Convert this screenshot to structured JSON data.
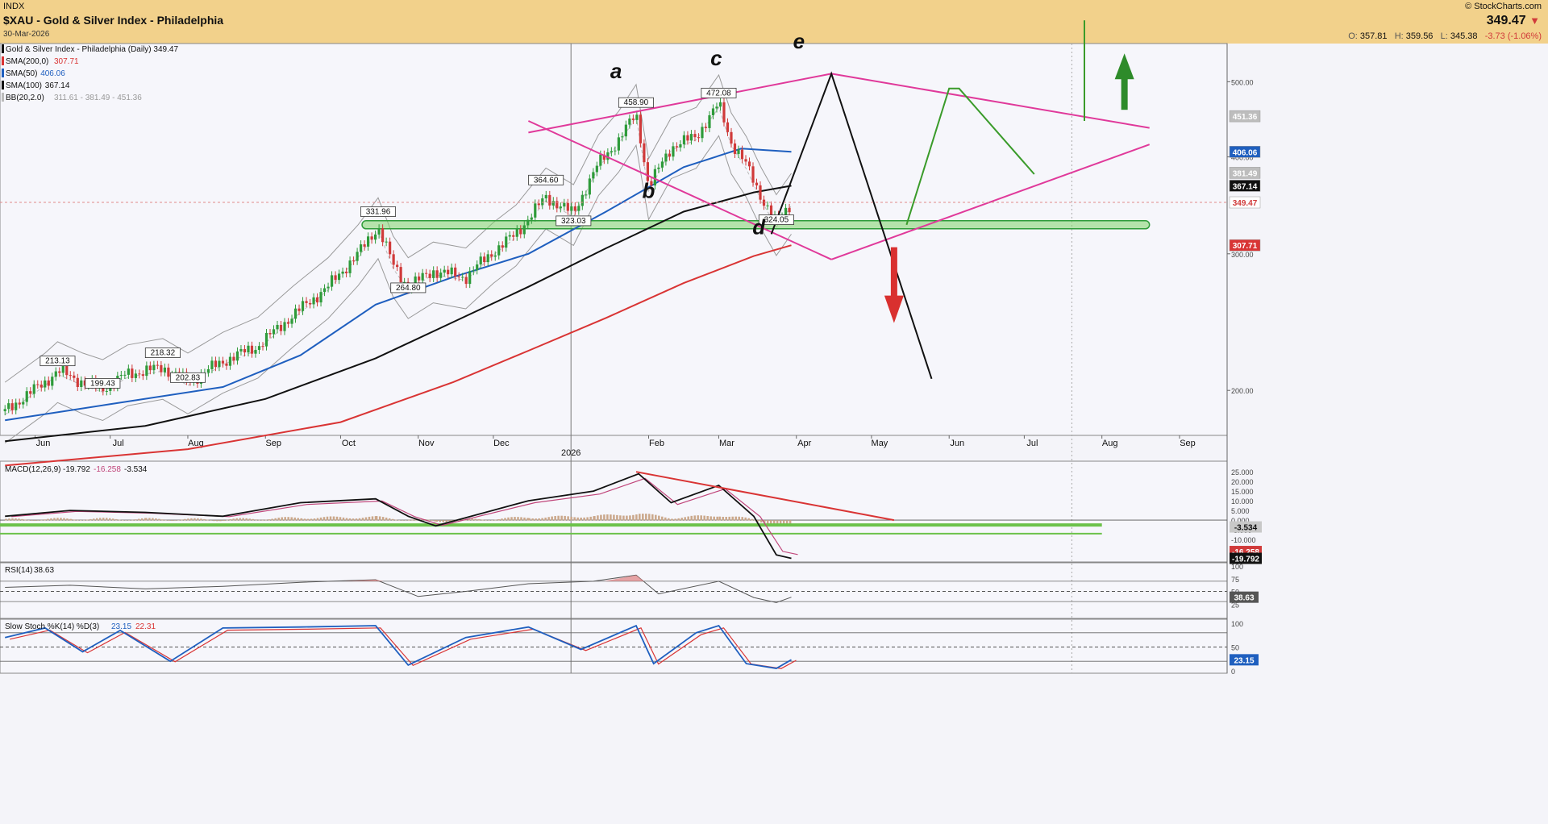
{
  "header": {
    "exchange": "INDX",
    "title": "$XAU - Gold & Silver Index - Philadelphia",
    "date": "30-Mar-2026",
    "brand": "© StockCharts.com",
    "last_price": "349.47",
    "ohlc_open_label": "O:",
    "ohlc_open": "357.81",
    "ohlc_high_label": "H:",
    "ohlc_high": "359.56",
    "ohlc_low_label": "L:",
    "ohlc_low": "345.38",
    "change": "-3.73 (-1.06%)"
  },
  "colors": {
    "header_bg": "#f2d18b",
    "up_candle": "#2e9b3a",
    "down_candle": "#d03a3a",
    "sma200": "#d93434",
    "sma50": "#1f5fbf",
    "sma100": "#111111",
    "bb": "#9a9a9a",
    "triangle": "#e0399a",
    "support_zone": "#7fd36a",
    "projection_green": "#3a9b2a",
    "projection_black": "#111111",
    "down_arrow": "#d9302f",
    "up_arrow": "#2e8b2a"
  },
  "legend_main": [
    {
      "label": "Gold & Silver Index - Philadelphia (Daily) 349.47",
      "values": "",
      "swatch": "#111111"
    },
    {
      "label": "SMA(200,0)",
      "values": "307.71",
      "swatch": "#d93434"
    },
    {
      "label": "SMA(50)",
      "values": "406.06",
      "swatch": "#1f5fbf"
    },
    {
      "label": "SMA(100)",
      "values": "367.14",
      "swatch": "#111111"
    },
    {
      "label": "BB(20,2.0)",
      "values": "311.61 - 381.49 - 451.36",
      "swatch": "#bbbbbb"
    }
  ],
  "chart_data": {
    "type": "line",
    "title": "$XAU - Gold & Silver Index - Philadelphia",
    "scale": "log",
    "ylim": [
      175,
      560
    ],
    "y_ticks": [
      "500.00",
      "400.00",
      "300.00",
      "200.00"
    ],
    "x_ticks": [
      "Jun",
      "Jul",
      "Aug",
      "Sep",
      "Oct",
      "Nov",
      "Dec",
      "2026",
      "Feb",
      "Mar",
      "Apr",
      "May",
      "Jun",
      "Jul",
      "Aug",
      "Sep"
    ],
    "x_year_label": "2026",
    "axis_badges": [
      {
        "text": "451.36",
        "value": 451.36,
        "color": "#bdbdbd",
        "text_color": "#ffffff"
      },
      {
        "text": "406.06",
        "value": 406.06,
        "color": "#1f5fbf",
        "text_color": "#ffffff"
      },
      {
        "text": "381.49",
        "value": 381.49,
        "color": "#bdbdbd",
        "text_color": "#ffffff"
      },
      {
        "text": "367.14",
        "value": 367.14,
        "color": "#111111",
        "text_color": "#ffffff"
      },
      {
        "text": "349.47",
        "value": 349.47,
        "color": "#ffffff",
        "text_color": "#d03a3a"
      },
      {
        "text": "307.71",
        "value": 307.71,
        "color": "#d93434",
        "text_color": "#ffffff"
      }
    ],
    "price_labels": [
      {
        "text": "213.13",
        "value": 213.13,
        "date": "2025-06-10"
      },
      {
        "text": "199.43",
        "value": 199.43,
        "date": "2025-06-28"
      },
      {
        "text": "218.32",
        "value": 218.32,
        "date": "2025-07-22"
      },
      {
        "text": "202.83",
        "value": 202.83,
        "date": "2025-08-01"
      },
      {
        "text": "331.96",
        "value": 331.96,
        "date": "2025-10-16"
      },
      {
        "text": "264.80",
        "value": 264.8,
        "date": "2025-10-28"
      },
      {
        "text": "364.60",
        "value": 364.6,
        "date": "2025-12-22"
      },
      {
        "text": "323.03",
        "value": 323.03,
        "date": "2026-01-02"
      },
      {
        "text": "458.90",
        "value": 458.9,
        "date": "2026-01-27"
      },
      {
        "text": "472.08",
        "value": 472.08,
        "date": "2026-03-01"
      },
      {
        "text": "324.05",
        "value": 324.05,
        "date": "2026-03-24"
      }
    ],
    "wave_labels": [
      {
        "text": "a",
        "value": 505,
        "date": "2026-01-19"
      },
      {
        "text": "b",
        "value": 354,
        "date": "2026-02-01"
      },
      {
        "text": "c",
        "value": 525,
        "date": "2026-02-28"
      },
      {
        "text": "d",
        "value": 318,
        "date": "2026-03-17"
      },
      {
        "text": "e",
        "value": 552,
        "date": "2026-04-02"
      }
    ],
    "close_series": [
      {
        "date": "2025-05-20",
        "close": 188
      },
      {
        "date": "2025-06-05",
        "close": 205
      },
      {
        "date": "2025-06-10",
        "close": 212
      },
      {
        "date": "2025-06-20",
        "close": 205
      },
      {
        "date": "2025-06-28",
        "close": 201
      },
      {
        "date": "2025-07-08",
        "close": 210
      },
      {
        "date": "2025-07-22",
        "close": 214
      },
      {
        "date": "2025-08-01",
        "close": 205
      },
      {
        "date": "2025-08-15",
        "close": 218
      },
      {
        "date": "2025-08-29",
        "close": 228
      },
      {
        "date": "2025-09-12",
        "close": 250
      },
      {
        "date": "2025-09-26",
        "close": 272
      },
      {
        "date": "2025-10-08",
        "close": 300
      },
      {
        "date": "2025-10-16",
        "close": 325
      },
      {
        "date": "2025-10-22",
        "close": 290
      },
      {
        "date": "2025-10-28",
        "close": 272
      },
      {
        "date": "2025-11-07",
        "close": 285
      },
      {
        "date": "2025-11-20",
        "close": 280
      },
      {
        "date": "2025-12-01",
        "close": 302
      },
      {
        "date": "2025-12-10",
        "close": 318
      },
      {
        "date": "2025-12-22",
        "close": 355
      },
      {
        "date": "2026-01-02",
        "close": 338
      },
      {
        "date": "2026-01-12",
        "close": 392
      },
      {
        "date": "2026-01-20",
        "close": 420
      },
      {
        "date": "2026-01-27",
        "close": 455
      },
      {
        "date": "2026-02-01",
        "close": 365
      },
      {
        "date": "2026-02-10",
        "close": 412
      },
      {
        "date": "2026-02-20",
        "close": 425
      },
      {
        "date": "2026-03-01",
        "close": 468
      },
      {
        "date": "2026-03-06",
        "close": 418
      },
      {
        "date": "2026-03-12",
        "close": 390
      },
      {
        "date": "2026-03-18",
        "close": 355
      },
      {
        "date": "2026-03-24",
        "close": 328
      },
      {
        "date": "2026-03-30",
        "close": 349.47
      }
    ],
    "sma50_series": [
      {
        "date": "2025-05-20",
        "value": 183
      },
      {
        "date": "2025-07-01",
        "value": 192
      },
      {
        "date": "2025-08-15",
        "value": 202
      },
      {
        "date": "2025-09-15",
        "value": 222
      },
      {
        "date": "2025-10-15",
        "value": 258
      },
      {
        "date": "2025-11-15",
        "value": 280
      },
      {
        "date": "2025-12-15",
        "value": 300
      },
      {
        "date": "2026-01-15",
        "value": 340
      },
      {
        "date": "2026-02-15",
        "value": 388
      },
      {
        "date": "2026-03-10",
        "value": 410
      },
      {
        "date": "2026-03-30",
        "value": 406.06
      }
    ],
    "sma100_series": [
      {
        "date": "2025-05-20",
        "value": 172
      },
      {
        "date": "2025-07-15",
        "value": 180
      },
      {
        "date": "2025-09-01",
        "value": 195
      },
      {
        "date": "2025-10-15",
        "value": 220
      },
      {
        "date": "2025-11-15",
        "value": 245
      },
      {
        "date": "2025-12-15",
        "value": 272
      },
      {
        "date": "2026-01-15",
        "value": 305
      },
      {
        "date": "2026-02-15",
        "value": 340
      },
      {
        "date": "2026-03-15",
        "value": 360
      },
      {
        "date": "2026-03-30",
        "value": 367.14
      }
    ],
    "sma200_series": [
      {
        "date": "2025-05-20",
        "value": 160
      },
      {
        "date": "2025-08-01",
        "value": 168
      },
      {
        "date": "2025-10-01",
        "value": 182
      },
      {
        "date": "2025-11-15",
        "value": 205
      },
      {
        "date": "2025-12-15",
        "value": 225
      },
      {
        "date": "2026-01-15",
        "value": 248
      },
      {
        "date": "2026-02-15",
        "value": 275
      },
      {
        "date": "2026-03-15",
        "value": 298
      },
      {
        "date": "2026-03-30",
        "value": 307.71
      }
    ],
    "annotations": {
      "triangle_upper": [
        {
          "date": "2025-12-15",
          "value": 430
        },
        {
          "date": "2026-04-15",
          "value": 512
        }
      ],
      "triangle_lower": [
        {
          "date": "2025-12-15",
          "value": 445
        },
        {
          "date": "2026-04-15",
          "value": 295
        }
      ],
      "projection_upper": [
        {
          "date": "2026-04-15",
          "value": 512
        },
        {
          "date": "2026-08-20",
          "value": 436
        }
      ],
      "projection_lower": [
        {
          "date": "2026-04-15",
          "value": 295
        },
        {
          "date": "2026-08-20",
          "value": 415
        }
      ],
      "support_zone": {
        "value": 327,
        "from": "2025-10-16",
        "to": "2026-08-20"
      },
      "path_e": [
        {
          "date": "2026-03-22",
          "value": 318
        },
        {
          "date": "2026-04-15",
          "value": 512
        },
        {
          "date": "2026-05-25",
          "value": 207
        }
      ],
      "path_green": [
        {
          "date": "2026-05-15",
          "value": 327
        },
        {
          "date": "2026-06-01",
          "value": 490
        },
        {
          "date": "2026-06-05",
          "value": 490
        },
        {
          "date": "2026-07-05",
          "value": 380
        }
      ],
      "breakout_line": [
        {
          "date": "2026-07-25",
          "value": 445
        },
        {
          "date": "2026-07-25",
          "value": 600
        }
      ],
      "up_arrow": {
        "date": "2026-08-10",
        "value": 460
      },
      "down_arrow": {
        "date": "2026-05-10",
        "value": 265
      }
    }
  },
  "macd": {
    "label": "MACD(12,26,9)",
    "value_macd": "-19.792",
    "value_signal": "-16.258",
    "value_hist": "-3.534",
    "ylim": [
      -20,
      28
    ],
    "y_ticks": [
      "25.000",
      "20.000",
      "15.000",
      "10.000",
      "5.000",
      "0.000",
      "-5.000",
      "-10.000",
      "-15.000"
    ],
    "badges": [
      {
        "text": "-3.534",
        "value": -3.534,
        "color": "#c8c8c8",
        "text_color": "#111"
      },
      {
        "text": "-16.258",
        "value": -16.258,
        "color": "#d03a3a",
        "text_color": "#fff"
      },
      {
        "text": "-19.792",
        "value": -19.792,
        "color": "#111111",
        "text_color": "#fff"
      }
    ],
    "macd_series": [
      {
        "date": "2025-05-20",
        "value": 2
      },
      {
        "date": "2025-06-15",
        "value": 5
      },
      {
        "date": "2025-07-15",
        "value": 4
      },
      {
        "date": "2025-08-15",
        "value": 2
      },
      {
        "date": "2025-09-15",
        "value": 9
      },
      {
        "date": "2025-10-15",
        "value": 11
      },
      {
        "date": "2025-10-28",
        "value": 2
      },
      {
        "date": "2025-11-08",
        "value": -3
      },
      {
        "date": "2025-11-25",
        "value": 3
      },
      {
        "date": "2025-12-15",
        "value": 10
      },
      {
        "date": "2026-01-10",
        "value": 15
      },
      {
        "date": "2026-01-28",
        "value": 24
      },
      {
        "date": "2026-02-10",
        "value": 9
      },
      {
        "date": "2026-03-01",
        "value": 18
      },
      {
        "date": "2026-03-15",
        "value": 2
      },
      {
        "date": "2026-03-24",
        "value": -18
      },
      {
        "date": "2026-03-30",
        "value": -19.792
      }
    ],
    "trend_line": [
      {
        "date": "2026-01-27",
        "value": 25
      },
      {
        "date": "2026-05-10",
        "value": 0
      }
    ],
    "green_lines": [
      -2.5,
      -7
    ]
  },
  "rsi": {
    "label": "RSI(14)",
    "value": "38.63",
    "ylim": [
      0,
      100
    ],
    "y_ticks": [
      "100",
      "75",
      "50",
      "25"
    ],
    "series": [
      {
        "date": "2025-05-20",
        "value": 58
      },
      {
        "date": "2025-06-15",
        "value": 62
      },
      {
        "date": "2025-07-15",
        "value": 55
      },
      {
        "date": "2025-08-15",
        "value": 60
      },
      {
        "date": "2025-09-15",
        "value": 68
      },
      {
        "date": "2025-10-15",
        "value": 73
      },
      {
        "date": "2025-11-01",
        "value": 40
      },
      {
        "date": "2025-11-20",
        "value": 50
      },
      {
        "date": "2025-12-15",
        "value": 65
      },
      {
        "date": "2026-01-10",
        "value": 70
      },
      {
        "date": "2026-01-27",
        "value": 82
      },
      {
        "date": "2026-02-05",
        "value": 45
      },
      {
        "date": "2026-03-01",
        "value": 70
      },
      {
        "date": "2026-03-15",
        "value": 38
      },
      {
        "date": "2026-03-24",
        "value": 28
      },
      {
        "date": "2026-03-30",
        "value": 38.63
      }
    ]
  },
  "stoch": {
    "label": "Slow Stoch %K(14) %D(3)",
    "value_k": "23.15",
    "value_d": "22.31",
    "ylim": [
      0,
      100
    ],
    "y_ticks": [
      "100",
      "50",
      "0"
    ],
    "series_k": [
      {
        "date": "2025-05-20",
        "value": 70
      },
      {
        "date": "2025-06-05",
        "value": 90
      },
      {
        "date": "2025-06-20",
        "value": 40
      },
      {
        "date": "2025-07-05",
        "value": 85
      },
      {
        "date": "2025-07-25",
        "value": 20
      },
      {
        "date": "2025-08-15",
        "value": 90
      },
      {
        "date": "2025-09-15",
        "value": 92
      },
      {
        "date": "2025-10-15",
        "value": 95
      },
      {
        "date": "2025-10-28",
        "value": 12
      },
      {
        "date": "2025-11-20",
        "value": 70
      },
      {
        "date": "2025-12-15",
        "value": 92
      },
      {
        "date": "2026-01-05",
        "value": 45
      },
      {
        "date": "2026-01-27",
        "value": 95
      },
      {
        "date": "2026-02-03",
        "value": 15
      },
      {
        "date": "2026-02-20",
        "value": 80
      },
      {
        "date": "2026-03-01",
        "value": 95
      },
      {
        "date": "2026-03-12",
        "value": 15
      },
      {
        "date": "2026-03-24",
        "value": 5
      },
      {
        "date": "2026-03-30",
        "value": 23.15
      }
    ]
  }
}
